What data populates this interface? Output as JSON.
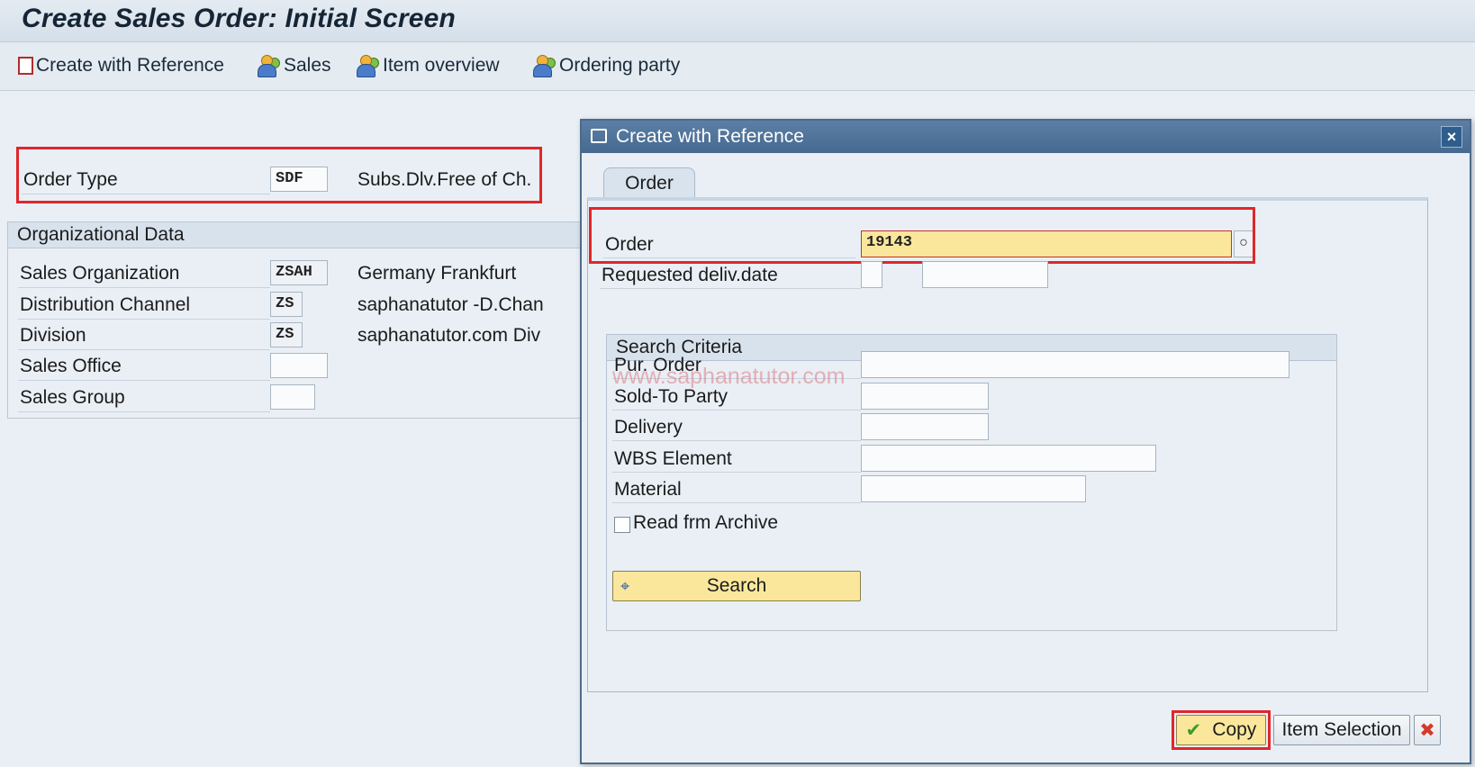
{
  "window": {
    "title": "Create Sales Order: Initial Screen"
  },
  "toolbar": {
    "create_with_reference": "Create with Reference",
    "sales": "Sales",
    "item_overview": "Item overview",
    "ordering_party": "Ordering party"
  },
  "order_type": {
    "label": "Order Type",
    "value": "SDF",
    "description": "Subs.Dlv.Free of Ch."
  },
  "org_data": {
    "header": "Organizational Data",
    "rows": [
      {
        "label": "Sales Organization",
        "value": "ZSAH",
        "description": "Germany Frankfurt"
      },
      {
        "label": "Distribution Channel",
        "value": "ZS",
        "description": "saphanatutor -D.Chan"
      },
      {
        "label": "Division",
        "value": "ZS",
        "description": "saphanatutor.com Div"
      },
      {
        "label": "Sales Office",
        "value": "",
        "description": ""
      },
      {
        "label": "Sales Group",
        "value": "",
        "description": ""
      }
    ]
  },
  "dialog": {
    "title": "Create with Reference",
    "tab": "Order",
    "order_label": "Order",
    "order_value": "19143",
    "req_deliv_label": "Requested deliv.date",
    "search_criteria": {
      "header": "Search Criteria",
      "pur_order": "Pur. Order",
      "sold_to_party": "Sold-To Party",
      "delivery": "Delivery",
      "wbs_element": "WBS Element",
      "material": "Material",
      "read_archive": "Read frm Archive",
      "search_button": "Search"
    },
    "watermark": "www.saphanatutor.com",
    "buttons": {
      "copy": "Copy",
      "item_selection": "Item Selection"
    }
  },
  "colors": {
    "highlight_red": "#e0262b",
    "dialog_title_bg": "#46698f",
    "input_yellow": "#fbe79c"
  }
}
